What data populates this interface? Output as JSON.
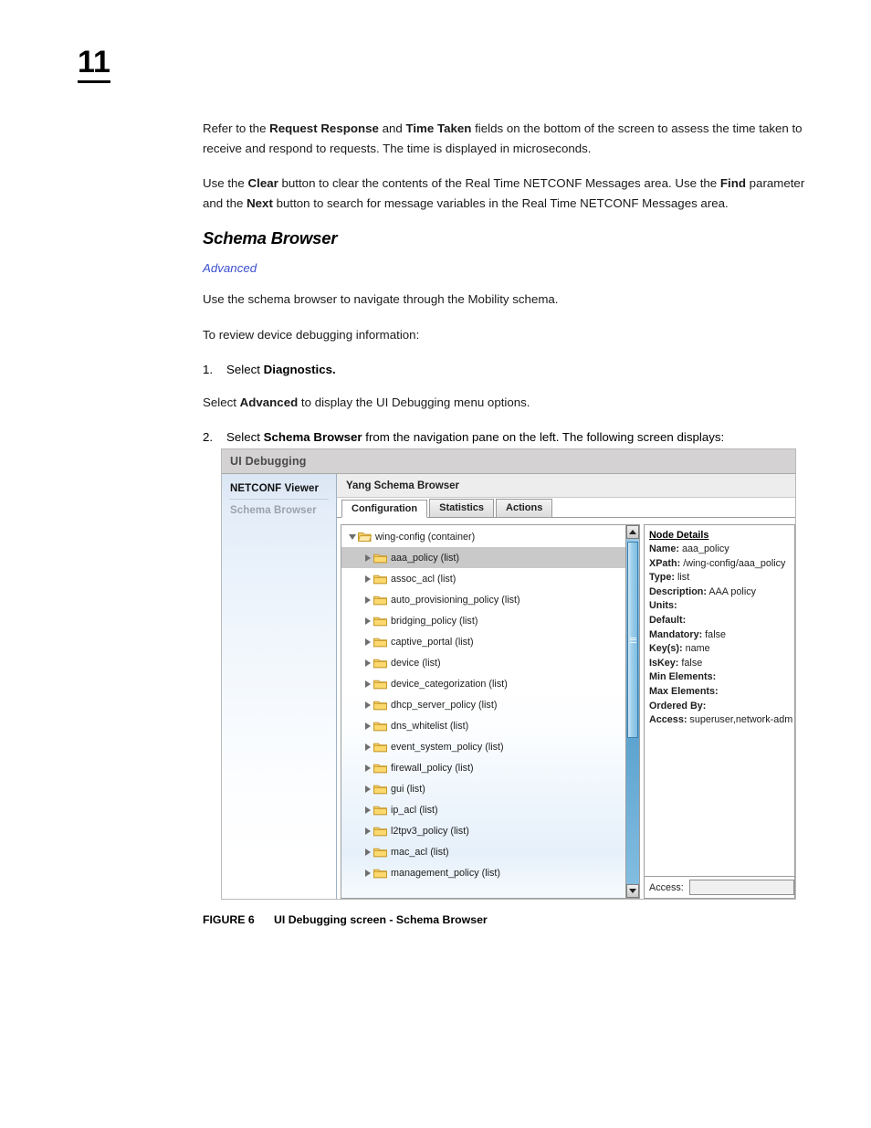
{
  "page": {
    "number": "11",
    "paragraphs": [
      {
        "runs": [
          {
            "t": "Refer to the ",
            "b": false
          },
          {
            "t": "Request Response",
            "b": true
          },
          {
            "t": " and ",
            "b": false
          },
          {
            "t": "Time Taken",
            "b": true
          },
          {
            "t": " fields on the bottom of the screen to assess the time taken to receive and respond to requests. The time is displayed in microseconds.",
            "b": false
          }
        ]
      },
      {
        "runs": [
          {
            "t": "Use the ",
            "b": false
          },
          {
            "t": "Clear",
            "b": true
          },
          {
            "t": " button to clear the contents of the Real Time NETCONF Messages area. Use the ",
            "b": false
          },
          {
            "t": "Find",
            "b": true
          },
          {
            "t": " parameter and the ",
            "b": false
          },
          {
            "t": "Next",
            "b": true
          },
          {
            "t": " button to search for message variables in the Real Time NETCONF Messages area.",
            "b": false
          }
        ]
      }
    ],
    "section_title": "Schema Browser",
    "section_subhead": "Advanced",
    "intro_paragraphs": [
      "Use the schema browser to navigate through the Mobility schema.",
      "To review device debugging information:"
    ],
    "steps": [
      {
        "num": "1.",
        "runs": [
          {
            "t": "Select ",
            "b": false
          },
          {
            "t": "Diagnostics.",
            "b": true
          }
        ]
      },
      {
        "num": "2.",
        "runs": [
          {
            "t": "Select ",
            "b": false
          },
          {
            "t": "Schema Browser",
            "b": true
          },
          {
            "t": " from the navigation pane on the left. The following screen displays:",
            "b": false
          }
        ]
      }
    ],
    "mid_paragraph": {
      "runs": [
        {
          "t": "Select ",
          "b": false
        },
        {
          "t": "Advanced",
          "b": true
        },
        {
          "t": " to display the UI Debugging menu options.",
          "b": false
        }
      ]
    },
    "figure": {
      "label": "FIGURE 6",
      "caption": "UI Debugging screen - Schema Browser"
    }
  },
  "screenshot": {
    "title": "UI Debugging",
    "sidebar": {
      "items": [
        {
          "label": "NETCONF Viewer",
          "selected": true
        },
        {
          "label": "Schema Browser",
          "selected": false
        }
      ]
    },
    "pane_title": "Yang Schema Browser",
    "tabs": [
      {
        "label": "Configuration",
        "active": true
      },
      {
        "label": "Statistics",
        "active": false
      },
      {
        "label": "Actions",
        "active": false
      }
    ],
    "tree": {
      "root": {
        "label": "wing-config (container)",
        "expanded": true,
        "icon": "folder-open-icon"
      },
      "nodes": [
        {
          "label": "aaa_policy (list)",
          "selected": true
        },
        {
          "label": "assoc_acl (list)",
          "selected": false
        },
        {
          "label": "auto_provisioning_policy (list)",
          "selected": false
        },
        {
          "label": "bridging_policy (list)",
          "selected": false
        },
        {
          "label": "captive_portal (list)",
          "selected": false
        },
        {
          "label": "device (list)",
          "selected": false
        },
        {
          "label": "device_categorization (list)",
          "selected": false
        },
        {
          "label": "dhcp_server_policy (list)",
          "selected": false
        },
        {
          "label": "dns_whitelist (list)",
          "selected": false
        },
        {
          "label": "event_system_policy (list)",
          "selected": false
        },
        {
          "label": "firewall_policy (list)",
          "selected": false
        },
        {
          "label": "gui (list)",
          "selected": false
        },
        {
          "label": "ip_acl (list)",
          "selected": false
        },
        {
          "label": "l2tpv3_policy (list)",
          "selected": false
        },
        {
          "label": "mac_acl (list)",
          "selected": false
        },
        {
          "label": "management_policy (list)",
          "selected": false
        }
      ]
    },
    "node_details": {
      "title": "Node Details",
      "fields": [
        {
          "key": "Name:",
          "value": "aaa_policy"
        },
        {
          "key": "XPath:",
          "value": "/wing-config/aaa_policy"
        },
        {
          "key": "Type:",
          "value": "list"
        },
        {
          "key": "Description:",
          "value": "AAA policy"
        },
        {
          "key": "Units:",
          "value": ""
        },
        {
          "key": "Default:",
          "value": ""
        },
        {
          "key": "Mandatory:",
          "value": "false"
        },
        {
          "key": "Key(s):",
          "value": "name"
        },
        {
          "key": "IsKey:",
          "value": "false"
        },
        {
          "key": "Min Elements:",
          "value": ""
        },
        {
          "key": "Max Elements:",
          "value": ""
        },
        {
          "key": "Ordered By:",
          "value": ""
        },
        {
          "key": "Access:",
          "value": "superuser,network-adm"
        }
      ]
    },
    "access_field": {
      "label": "Access:",
      "value": ""
    }
  }
}
